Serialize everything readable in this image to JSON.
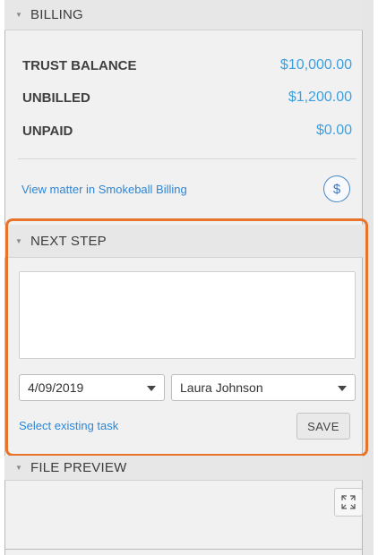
{
  "billing": {
    "header": "BILLING",
    "rows": [
      {
        "label": "TRUST BALANCE",
        "value": "$10,000.00"
      },
      {
        "label": "UNBILLED",
        "value": "$1,200.00"
      },
      {
        "label": "UNPAID",
        "value": "$0.00"
      }
    ],
    "link": "View matter in Smokeball Billing",
    "icon": "dollar-circle-icon",
    "icon_glyph": "$"
  },
  "next_step": {
    "header": "NEXT STEP",
    "note_value": "",
    "date_value": "4/09/2019",
    "assignee_value": "Laura Johnson",
    "select_task_link": "Select existing task",
    "save_label": "SAVE"
  },
  "file_preview": {
    "header": "FILE PREVIEW",
    "expand_icon": "expand-icon"
  },
  "colors": {
    "accent_blue": "#3ca0e0",
    "link_blue": "#2e86d4",
    "highlight_orange": "#e8742a"
  }
}
